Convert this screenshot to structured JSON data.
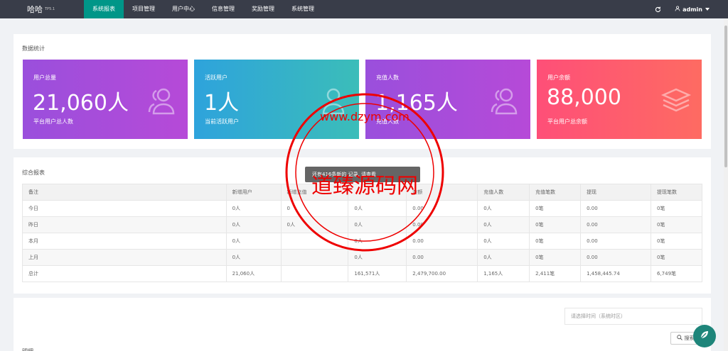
{
  "header": {
    "logo": "哈哈",
    "version": "TP5.1",
    "nav": [
      "系统报表",
      "项目管理",
      "用户中心",
      "信息管理",
      "奖励管理",
      "系统管理"
    ],
    "active_index": 0,
    "user": "admin"
  },
  "stats": {
    "title": "数据统计",
    "cards": [
      {
        "label": "用户总量",
        "value": "21,060人",
        "sub": "平台用户总人数",
        "icon": "users-icon"
      },
      {
        "label": "活跃用户",
        "value": "1人",
        "sub": "当前活跃用户",
        "icon": "user-icon"
      },
      {
        "label": "充值人数",
        "value": "1,165人",
        "sub": "充值人数",
        "icon": "users-icon"
      },
      {
        "label": "用户余额",
        "value": "88,000",
        "sub": "平台用户总余额",
        "icon": "layers-icon"
      }
    ]
  },
  "report": {
    "title": "综合报表",
    "columns": [
      "备注",
      "新增用户",
      "新增充值",
      "",
      "金额",
      "充值人数",
      "充值笔数",
      "提现",
      "提现笔数"
    ],
    "rows": [
      [
        "今日",
        "0人",
        "0",
        "0人",
        "0.00",
        "0人",
        "0笔",
        "0.00",
        "0笔"
      ],
      [
        "昨日",
        "0人",
        "0人",
        "0人",
        "0.00",
        "0人",
        "0笔",
        "0.00",
        "0笔"
      ],
      [
        "本月",
        "0人",
        "",
        "0人",
        "0.00",
        "0人",
        "0笔",
        "0.00",
        "0笔"
      ],
      [
        "上月",
        "0人",
        "",
        "0人",
        "0.00",
        "0人",
        "0笔",
        "0.00",
        "0笔"
      ],
      [
        "总计",
        "21,060人",
        "",
        "161,571人",
        "2,479,700.00",
        "1,165人",
        "2,411笔",
        "1,458,445.74",
        "6,749笔"
      ]
    ]
  },
  "tooltip": "还有416条新的 记录, 请查看",
  "search": {
    "placeholder": "请选择时间（系统时区）",
    "button": "搜索",
    "detail": "明细"
  },
  "watermark": {
    "text": "道臻源码网",
    "url": "www.dzym.com"
  }
}
